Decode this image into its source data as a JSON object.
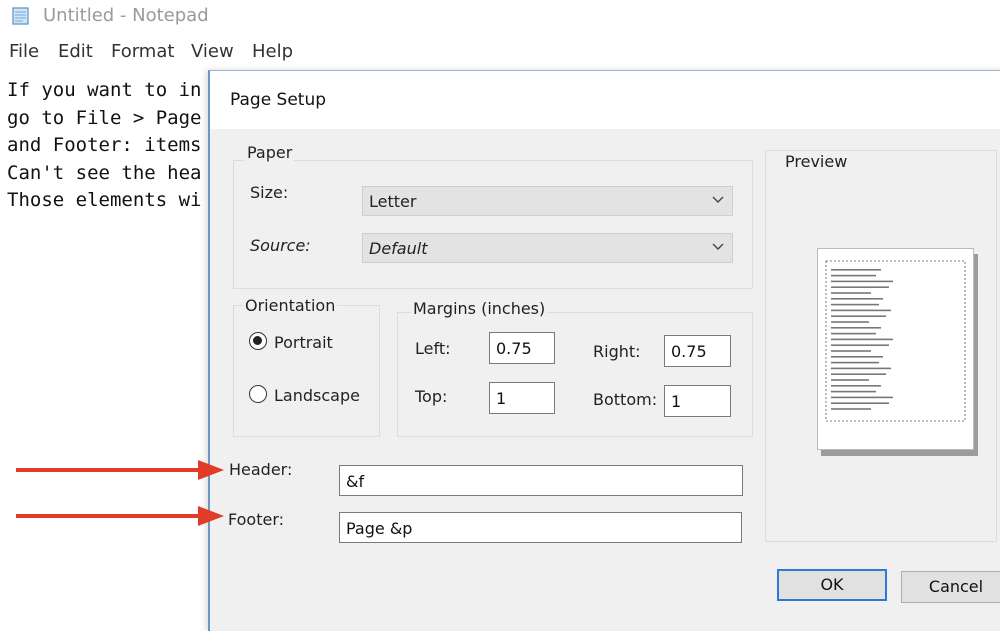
{
  "notepad": {
    "title": "Untitled - Notepad",
    "menu": [
      "File",
      "Edit",
      "Format",
      "View",
      "Help"
    ],
    "text_lines": [
      "If you want to in",
      "go to File > Page",
      "and Footer: items",
      "Can't see the hea",
      "Those elements wi"
    ]
  },
  "dialog": {
    "title": "Page Setup",
    "paper": {
      "group_label": "Paper",
      "size_label": "Size:",
      "size_value": "Letter",
      "source_label": "Source:",
      "source_value": "Default"
    },
    "orientation": {
      "group_label": "Orientation",
      "portrait_label": "Portrait",
      "landscape_label": "Landscape",
      "selected": "Portrait"
    },
    "margins": {
      "group_label": "Margins (inches)",
      "left_label": "Left:",
      "left_value": "0.75",
      "right_label": "Right:",
      "right_value": "0.75",
      "top_label": "Top:",
      "top_value": "1",
      "bottom_label": "Bottom:",
      "bottom_value": "1"
    },
    "header_label": "Header:",
    "header_value": "&f",
    "footer_label": "Footer:",
    "footer_value": "Page &p",
    "preview_label": "Preview",
    "ok_label": "OK",
    "cancel_label": "Cancel"
  },
  "annotation": {
    "arrow_color": "#e03c28"
  }
}
